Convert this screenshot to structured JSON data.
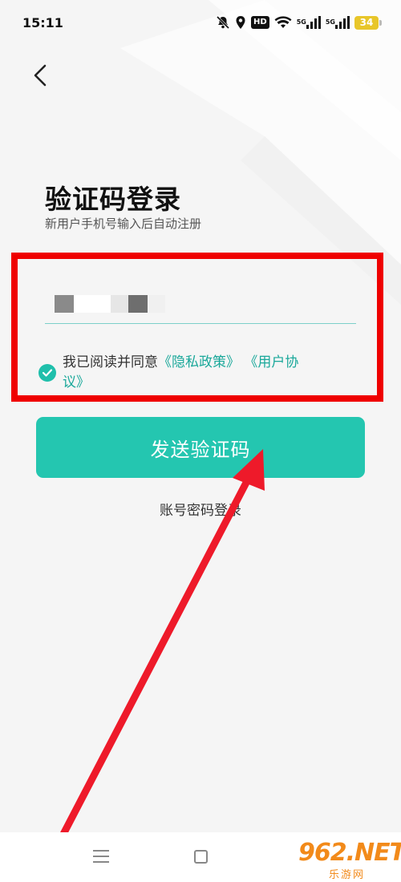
{
  "status_bar": {
    "time": "15:11",
    "hd_label": "HD",
    "sim1_tag": "5G",
    "sim2_tag": "5G",
    "battery": "34"
  },
  "page": {
    "title": "验证码登录",
    "subtitle": "新用户手机号输入后自动注册"
  },
  "phone_input": {
    "value": ""
  },
  "agreement": {
    "prefix": "我已阅读并同意",
    "privacy_link": "《隐私政策》",
    "user_link_part1": "《用户协",
    "user_link_part2": "议》",
    "checked": true
  },
  "actions": {
    "send_code": "发送验证码",
    "password_login": "账号密码登录"
  },
  "watermark": {
    "main": "962.NET",
    "sub": "乐游网"
  },
  "colors": {
    "accent": "#24c6b0",
    "link": "#1aa89a",
    "highlight": "#ef0000",
    "arrow": "#ee1a2a"
  }
}
